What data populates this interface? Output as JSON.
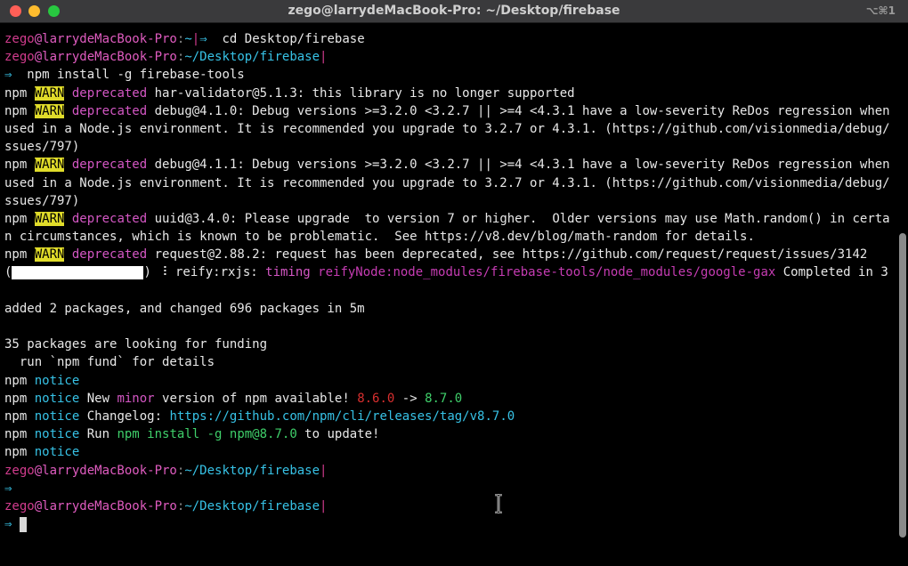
{
  "window": {
    "title": "zego@larrydeMacBook-Pro: ~/Desktop/firebase",
    "shortcut": "⌥⌘1",
    "buttons": {
      "close_color": "#ff5f57",
      "minimize_color": "#febc2e",
      "maximize_color": "#28c840"
    }
  },
  "colors": {
    "prompt_user": "#d23c8e",
    "prompt_host": "#e05cc0",
    "path": "#37c2e6",
    "dim": "#8a8a8a",
    "deprecated": "#d457c4",
    "warn_bg": "#e0dc2a",
    "timing": "#d457c4",
    "reify_path": "#c63cb3",
    "notice": "#37c2e6",
    "minor": "#d457c4",
    "old_version": "#d82f2f",
    "new_version": "#3fcf6a",
    "link": "#37c2e6",
    "cmd": "#3fcf6a",
    "default": "#e8e8e8"
  },
  "lines": [
    [
      {
        "t": "zego",
        "c": "prompt_user"
      },
      {
        "t": "@larrydeMacBook-Pro",
        "c": "prompt_host"
      },
      {
        "t": ":",
        "c": "dim"
      },
      {
        "t": "~",
        "c": "path"
      },
      {
        "t": "|",
        "c": "prompt_user"
      },
      {
        "t": "⇒",
        "c": "path"
      },
      {
        "t": "  cd Desktop/firebase",
        "c": "default"
      }
    ],
    [
      {
        "t": "zego",
        "c": "prompt_user"
      },
      {
        "t": "@larrydeMacBook-Pro",
        "c": "prompt_host"
      },
      {
        "t": ":",
        "c": "dim"
      },
      {
        "t": "~/Desktop/firebase",
        "c": "path"
      },
      {
        "t": "|",
        "c": "prompt_user"
      }
    ],
    [
      {
        "t": "⇒",
        "c": "path"
      },
      {
        "t": "  npm install -g firebase-tools",
        "c": "default"
      }
    ],
    [
      {
        "t": "npm ",
        "c": "default"
      },
      {
        "t": "WARN",
        "c": "warn"
      },
      {
        "t": " ",
        "c": "default"
      },
      {
        "t": "deprecated",
        "c": "deprecated"
      },
      {
        "t": " har-validator@5.1.3: this library is no longer supported",
        "c": "default"
      }
    ],
    [
      {
        "t": "npm ",
        "c": "default"
      },
      {
        "t": "WARN",
        "c": "warn"
      },
      {
        "t": " ",
        "c": "default"
      },
      {
        "t": "deprecated",
        "c": "deprecated"
      },
      {
        "t": " debug@4.1.0: Debug versions >=3.2.0 <3.2.7 || >=4 <4.3.1 have a low-severity ReDos regression when",
        "c": "default"
      }
    ],
    [
      {
        "t": "used in a Node.js environment. It is recommended you upgrade to 3.2.7 or 4.3.1. (https://github.com/visionmedia/debug/i",
        "c": "default"
      }
    ],
    [
      {
        "t": "ssues/797)",
        "c": "default"
      }
    ],
    [
      {
        "t": "npm ",
        "c": "default"
      },
      {
        "t": "WARN",
        "c": "warn"
      },
      {
        "t": " ",
        "c": "default"
      },
      {
        "t": "deprecated",
        "c": "deprecated"
      },
      {
        "t": " debug@4.1.1: Debug versions >=3.2.0 <3.2.7 || >=4 <4.3.1 have a low-severity ReDos regression when",
        "c": "default"
      }
    ],
    [
      {
        "t": "used in a Node.js environment. It is recommended you upgrade to 3.2.7 or 4.3.1. (https://github.com/visionmedia/debug/i",
        "c": "default"
      }
    ],
    [
      {
        "t": "ssues/797)",
        "c": "default"
      }
    ],
    [
      {
        "t": "npm ",
        "c": "default"
      },
      {
        "t": "WARN",
        "c": "warn"
      },
      {
        "t": " ",
        "c": "default"
      },
      {
        "t": "deprecated",
        "c": "deprecated"
      },
      {
        "t": " uuid@3.4.0: Please upgrade  to version 7 or higher.  Older versions may use Math.random() in certai",
        "c": "default"
      }
    ],
    [
      {
        "t": "n circumstances, which is known to be problematic.  See https://v8.dev/blog/math-random for details.",
        "c": "default"
      }
    ],
    [
      {
        "t": "npm ",
        "c": "default"
      },
      {
        "t": "WARN",
        "c": "warn"
      },
      {
        "t": " ",
        "c": "default"
      },
      {
        "t": "deprecated",
        "c": "deprecated"
      },
      {
        "t": " request@2.88.2: request has been deprecated, see https://github.com/request/request/issues/3142",
        "c": "default"
      }
    ],
    [
      {
        "t": "(",
        "c": "default"
      },
      {
        "t": "",
        "c": "redacted"
      },
      {
        "t": ") ",
        "c": "default"
      },
      {
        "t": "⠸",
        "c": "default"
      },
      {
        "t": " reify:rxjs: ",
        "c": "default"
      },
      {
        "t": "timing",
        "c": "timing"
      },
      {
        "t": " ",
        "c": "default"
      },
      {
        "t": "reifyNode:node_modules/firebase-tools/node_modules/google-gax",
        "c": "reify_path"
      },
      {
        "t": " Completed in 3",
        "c": "default"
      }
    ],
    [],
    [
      {
        "t": "added 2 packages, and changed 696 packages in 5m",
        "c": "default"
      }
    ],
    [],
    [
      {
        "t": "35 packages are looking for funding",
        "c": "default"
      }
    ],
    [
      {
        "t": "  run `npm fund` for details",
        "c": "default"
      }
    ],
    [
      {
        "t": "npm ",
        "c": "default"
      },
      {
        "t": "notice",
        "c": "notice"
      }
    ],
    [
      {
        "t": "npm ",
        "c": "default"
      },
      {
        "t": "notice",
        "c": "notice"
      },
      {
        "t": " New ",
        "c": "default"
      },
      {
        "t": "minor",
        "c": "minor"
      },
      {
        "t": " version of npm available! ",
        "c": "default"
      },
      {
        "t": "8.6.0",
        "c": "old_version"
      },
      {
        "t": " -> ",
        "c": "default"
      },
      {
        "t": "8.7.0",
        "c": "new_version"
      }
    ],
    [
      {
        "t": "npm ",
        "c": "default"
      },
      {
        "t": "notice",
        "c": "notice"
      },
      {
        "t": " Changelog: ",
        "c": "default"
      },
      {
        "t": "https://github.com/npm/cli/releases/tag/v8.7.0",
        "c": "link"
      }
    ],
    [
      {
        "t": "npm ",
        "c": "default"
      },
      {
        "t": "notice",
        "c": "notice"
      },
      {
        "t": " Run ",
        "c": "default"
      },
      {
        "t": "npm install -g npm@8.7.0",
        "c": "cmd"
      },
      {
        "t": " to update!",
        "c": "default"
      }
    ],
    [
      {
        "t": "npm ",
        "c": "default"
      },
      {
        "t": "notice",
        "c": "notice"
      }
    ],
    [
      {
        "t": "zego",
        "c": "prompt_user"
      },
      {
        "t": "@larrydeMacBook-Pro",
        "c": "prompt_host"
      },
      {
        "t": ":",
        "c": "dim"
      },
      {
        "t": "~/Desktop/firebase",
        "c": "path"
      },
      {
        "t": "|",
        "c": "prompt_user"
      }
    ],
    [
      {
        "t": "⇒",
        "c": "path"
      }
    ],
    [
      {
        "t": "zego",
        "c": "prompt_user"
      },
      {
        "t": "@larrydeMacBook-Pro",
        "c": "prompt_host"
      },
      {
        "t": ":",
        "c": "dim"
      },
      {
        "t": "~/Desktop/firebase",
        "c": "path"
      },
      {
        "t": "|",
        "c": "prompt_user"
      }
    ],
    [
      {
        "t": "⇒",
        "c": "path"
      },
      {
        "t": " ",
        "c": "default"
      },
      {
        "t": "",
        "c": "cursor"
      }
    ]
  ]
}
